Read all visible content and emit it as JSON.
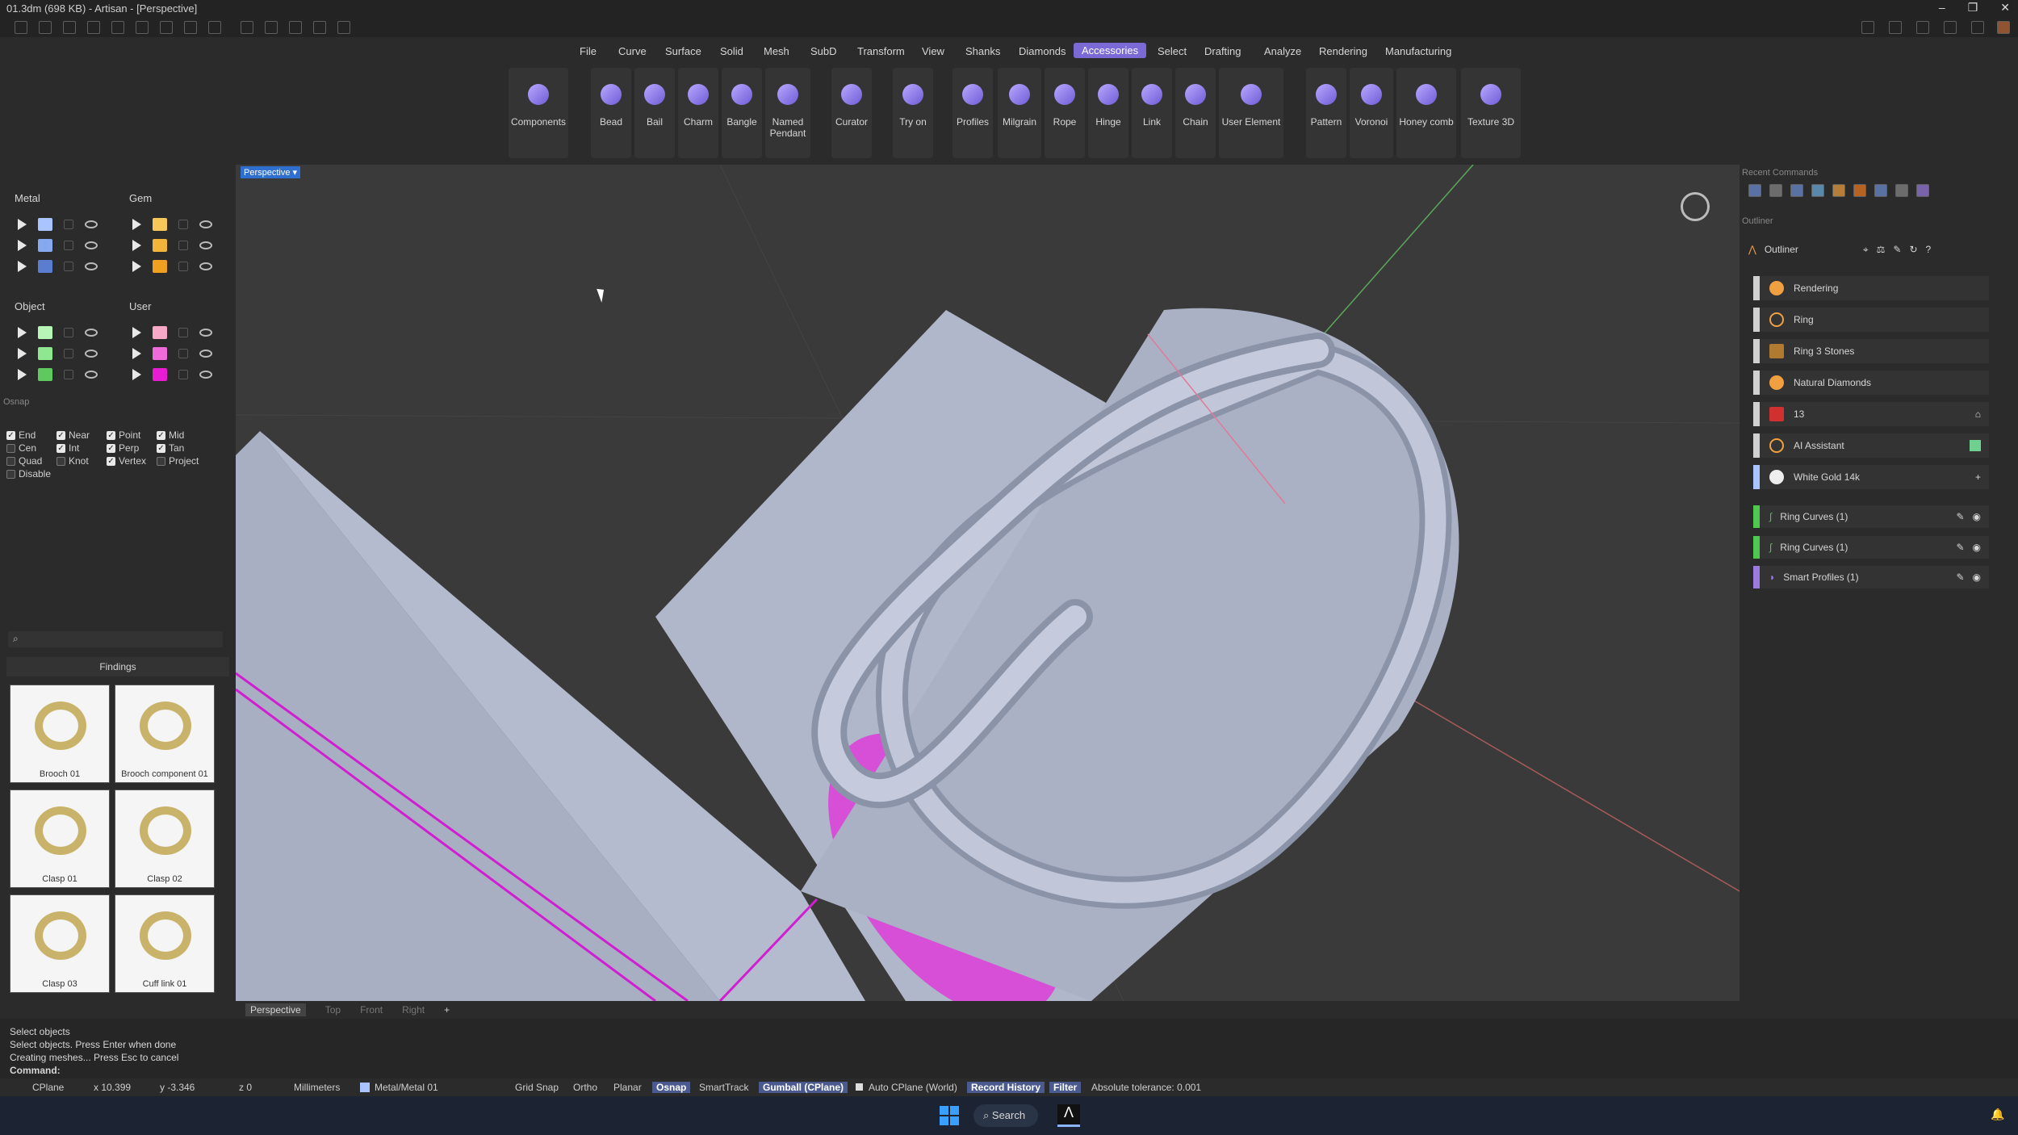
{
  "window": {
    "title": "01.3dm (698 KB) - Artisan - [Perspective]"
  },
  "menu": {
    "items": [
      "File",
      "Curve",
      "Surface",
      "Solid",
      "Mesh",
      "SubD",
      "Transform",
      "View",
      "Shanks",
      "Diamonds",
      "Accessories",
      "Select",
      "Drafting",
      "Analyze",
      "Rendering",
      "Manufacturing"
    ],
    "active": "Accessories"
  },
  "ribbon": {
    "tools": [
      "Components",
      "Bead",
      "Bail",
      "Charm",
      "Bangle",
      "Named Pendant",
      "Curator",
      "Try on",
      "Profiles",
      "Milgrain",
      "Rope",
      "Hinge",
      "Link",
      "Chain",
      "User Element",
      "Pattern",
      "Voronoi",
      "Honey comb",
      "Texture 3D"
    ]
  },
  "layers": {
    "metal": "Metal",
    "gem": "Gem",
    "object": "Object",
    "user": "User",
    "metal_colors": [
      "#a9c4ff",
      "#86a8ee",
      "#5b7dd0"
    ],
    "gem_colors": [
      "#f6c85a",
      "#f3b43a",
      "#f0a020"
    ],
    "object_colors": [
      "#b8f6b8",
      "#8fe88f",
      "#5fc95f"
    ],
    "user_colors": [
      "#f7a9c7",
      "#f06ad9",
      "#e81cd2"
    ]
  },
  "osnap": {
    "title": "Osnap",
    "items": [
      {
        "label": "End",
        "checked": true
      },
      {
        "label": "Near",
        "checked": true
      },
      {
        "label": "Point",
        "checked": true
      },
      {
        "label": "Mid",
        "checked": true
      },
      {
        "label": "Cen",
        "checked": false
      },
      {
        "label": "Int",
        "checked": true
      },
      {
        "label": "Perp",
        "checked": true
      },
      {
        "label": "Tan",
        "checked": true
      },
      {
        "label": "Quad",
        "checked": false
      },
      {
        "label": "Knot",
        "checked": false
      },
      {
        "label": "Vertex",
        "checked": true
      },
      {
        "label": "Project",
        "checked": false
      },
      {
        "label": "Disable",
        "checked": false
      }
    ]
  },
  "library": {
    "category": "Findings",
    "items": [
      "Brooch 01",
      "Brooch component 01",
      "Clasp 01",
      "Clasp 02",
      "Clasp 03",
      "Cuff link 01"
    ]
  },
  "viewport": {
    "label": "Perspective",
    "tabs": [
      "Perspective",
      "Top",
      "Front",
      "Right"
    ],
    "add_tab": "+"
  },
  "recent": {
    "title": "Recent Commands"
  },
  "outliner": {
    "section": "Outliner",
    "title": "Outliner",
    "rows": [
      "Rendering",
      "Ring",
      "Ring 3 Stones",
      "Natural Diamonds",
      "13",
      "AI Assistant",
      "White Gold 14k"
    ],
    "objects": [
      "Ring Curves (1)",
      "Ring Curves (1)",
      "Smart Profiles (1)"
    ],
    "object_colors": [
      "#4fc84f",
      "#4fc84f",
      "#9b7be0"
    ]
  },
  "command": {
    "history": [
      "Select objects",
      "Select objects. Press Enter when done",
      "Creating meshes... Press Esc to cancel"
    ],
    "prompt": "Command:"
  },
  "status": {
    "cplane": "CPlane",
    "x": "x 10.399",
    "y": "y -3.346",
    "z": "z 0",
    "units": "Millimeters",
    "layer": "Metal/Metal 01",
    "grid_snap": "Grid Snap",
    "ortho": "Ortho",
    "planar": "Planar",
    "osnap": "Osnap",
    "smarttrack": "SmartTrack",
    "gumball": "Gumball (CPlane)",
    "auto_cplane": "Auto CPlane (World)",
    "record_history": "Record History",
    "filter": "Filter",
    "tolerance": "Absolute tolerance: 0.001"
  },
  "taskbar": {
    "search": "Search"
  }
}
